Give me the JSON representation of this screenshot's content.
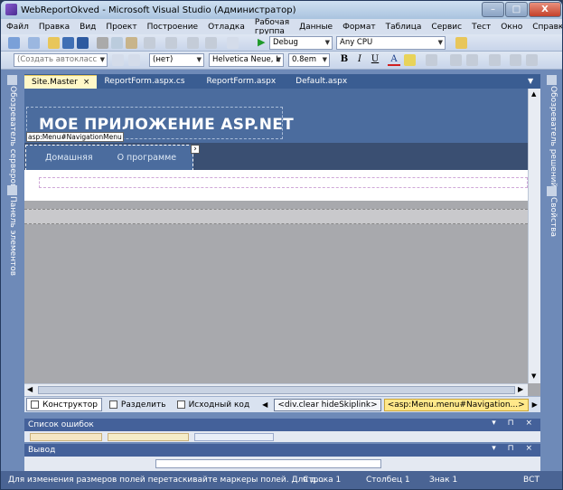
{
  "window": {
    "title": "WebReportOkved - Microsoft Visual Studio (Администратор)",
    "minimize": "–",
    "maximize": "□",
    "close": "X"
  },
  "menu": [
    "Файл",
    "Правка",
    "Вид",
    "Проект",
    "Построение",
    "Отладка",
    "Рабочая группа",
    "Данные",
    "Формат",
    "Таблица",
    "Сервис",
    "Тест",
    "Окно",
    "Справка"
  ],
  "toolbar": {
    "config": "Debug",
    "platform": "Any CPU",
    "style_class": "(Создать автокласс",
    "block_format": "(нет)",
    "font": "Helvetica Neue, L",
    "font_size": "0.8em",
    "bold": "B",
    "italic": "I",
    "underline": "U",
    "font_color": "A"
  },
  "left_side": {
    "server_explorer": "Обозреватель серверов",
    "toolbox": "Панель элементов"
  },
  "right_side": {
    "solution_explorer": "Обозреватель решений",
    "properties": "Свойства"
  },
  "tabs": [
    {
      "label": "Site.Master",
      "active": true
    },
    {
      "label": "ReportForm.aspx.cs"
    },
    {
      "label": "ReportForm.aspx"
    },
    {
      "label": "Default.aspx"
    }
  ],
  "tab_close": "×",
  "designer": {
    "app_title": "МОЕ ПРИЛОЖЕНИЕ ASP.NET",
    "menu_tag": "asp:Menu#NavigationMenu",
    "nav_items": [
      "Домашняя",
      "О программе"
    ],
    "smart_tag": "›"
  },
  "view_bar": {
    "design": "Конструктор",
    "split": "Разделить",
    "source": "Исходный код",
    "crumbs": [
      "<div.clear hideSkiplink>",
      "<asp:Menu.menu#Navigation...>"
    ]
  },
  "panels": {
    "errors": "Список ошибок",
    "output": "Вывод"
  },
  "status": {
    "message": "Для изменения размеров полей перетаскивайте маркеры полей. Для д...",
    "line": "Строка 1",
    "column": "Столбец 1",
    "char": "Знак 1",
    "mode": "ВСТ"
  }
}
